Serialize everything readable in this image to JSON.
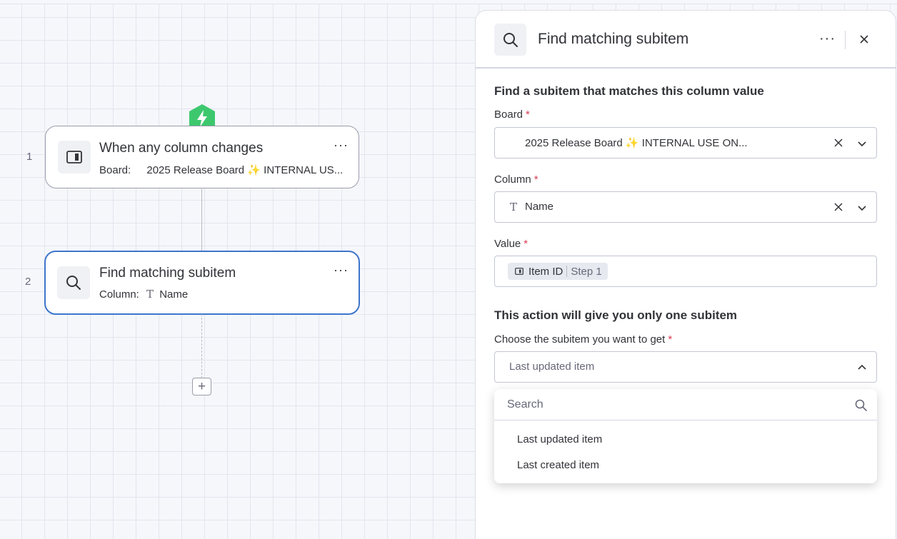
{
  "canvas": {
    "steps": [
      {
        "number": "1",
        "title": "When any column changes",
        "sub_label": "Board:",
        "sub_value": "2025 Release Board ✨ INTERNAL US...",
        "icon": "board-icon"
      },
      {
        "number": "2",
        "title": "Find matching subitem",
        "sub_label": "Column:",
        "sub_value": "Name",
        "icon": "search-icon"
      }
    ],
    "more": "···",
    "add": "+"
  },
  "panel": {
    "title": "Find matching subitem",
    "more": "···",
    "section1_title": "Find a subitem that matches this column value",
    "board": {
      "label": "Board",
      "value": "2025 Release Board ✨ INTERNAL USE ON..."
    },
    "column": {
      "label": "Column",
      "value": "Name"
    },
    "value": {
      "label": "Value",
      "chip_label": "Item ID",
      "chip_step": "Step 1"
    },
    "section2_title": "This action will give you only one subitem",
    "choose": {
      "label": "Choose the subitem you want to get",
      "placeholder": "Last updated item"
    },
    "required_mark": "*",
    "dropdown": {
      "search_placeholder": "Search",
      "options": [
        "Last updated item",
        "Last created item"
      ]
    }
  },
  "colors": {
    "accent": "#3d75cc",
    "trigger": "#3dc86e",
    "required": "#d83a52"
  }
}
